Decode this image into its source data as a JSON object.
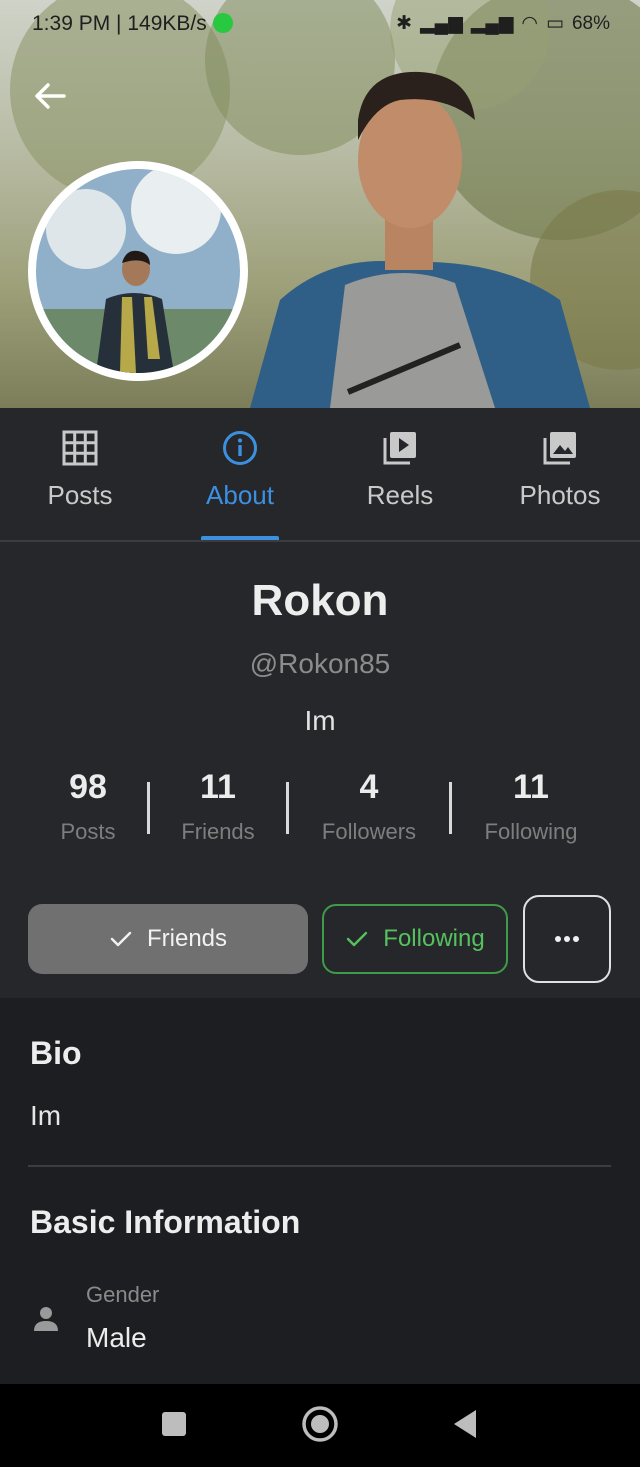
{
  "status_bar": {
    "time_speed": "1:39 PM | 149KB/s",
    "battery": "68%"
  },
  "tabs": [
    {
      "label": "Posts",
      "icon": "grid-icon"
    },
    {
      "label": "About",
      "icon": "info-icon",
      "active": true
    },
    {
      "label": "Reels",
      "icon": "reels-icon"
    },
    {
      "label": "Photos",
      "icon": "photos-icon"
    }
  ],
  "profile": {
    "name": "Rokon",
    "handle": "@Rokon85",
    "bio_short": "Im",
    "stats": [
      {
        "value": "98",
        "label": "Posts"
      },
      {
        "value": "11",
        "label": "Friends"
      },
      {
        "value": "4",
        "label": "Followers"
      },
      {
        "value": "11",
        "label": "Following"
      }
    ]
  },
  "actions": {
    "friends_label": "Friends",
    "following_label": "Following"
  },
  "about": {
    "bio_title": "Bio",
    "bio_text": "Im",
    "basic_title": "Basic Information",
    "gender_label": "Gender",
    "gender_value": "Male"
  },
  "colors": {
    "accent": "#3d8fe0",
    "following_green": "#56c15f",
    "background": "#25272a",
    "section_bg": "#1c1e21"
  }
}
